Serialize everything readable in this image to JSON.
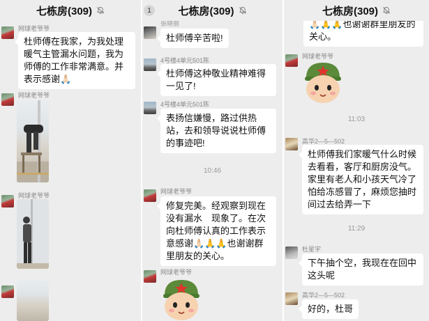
{
  "chat_title": "七栋房(309)",
  "unread_badge": "1",
  "panel1": {
    "msg1_sender": "网球老爷爷",
    "msg1_text": "杜师傅在我家，为我处理暖气主管漏水问题，我为师傅的工作非常满意。并表示感谢🙏🏻",
    "msg2_sender": "网球老爷爷",
    "msg3_sender": "网球老爷爷"
  },
  "panel2": {
    "cut_sender": "张晓丽",
    "msg1_text": "杜师傅辛苦啦!",
    "msg2_sender": "4号楼4单元501陈",
    "msg2_text": "杜师傅这种敬业精神难得一见了!",
    "msg3_sender": "4号楼4单元501陈",
    "msg3_text": "表扬信嫌慢，路过供热站，去和领导说说杜师傅的事迹吧!",
    "time1": "10:46",
    "msg4_sender": "网球老爷爷",
    "msg4_text": "修复完美。经观察到现在没有漏水　现象了。在次向杜师傅认真的工作表示意感谢🙏🏻🙏🙏也谢谢群里朋友的关心。",
    "msg5_sender": "网球老爷爷"
  },
  "panel3": {
    "cont_text": "🙏🏻🙏🙏也谢谢群里朋友的关心。",
    "msg1_sender": "网球老爷爷",
    "time1": "11:03",
    "msg2_sender": "高华2—5—502",
    "msg2_text": "杜师傅我们家暖气什么时候去看看，客厅和厨房没气。家里有老人和小孩天气冷了怕给冻感冒了，麻烦您抽时间过去给弄一下",
    "time2": "11:29",
    "msg3_sender": "杜星宇",
    "msg3_text": "下午抽个空，我现在在回中这头呢",
    "msg4_sender": "高华2—5—502",
    "msg4_text": "好的，杜哥"
  }
}
